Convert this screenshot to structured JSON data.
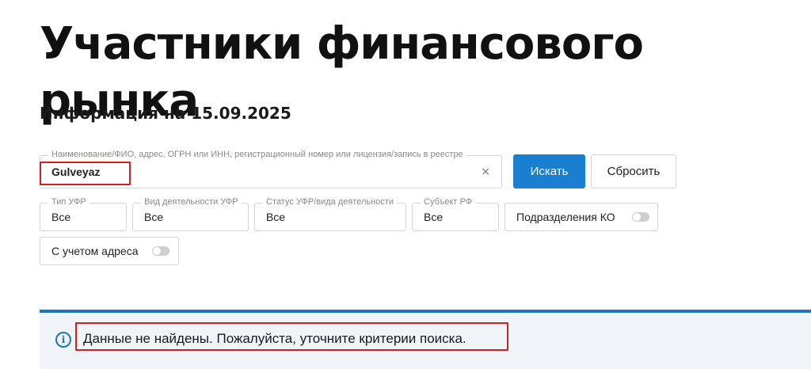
{
  "header": {
    "title": "Участники финансового рынка",
    "info_date": "Информация на 15.09.2025"
  },
  "search": {
    "legend": "Наименование/ФИО, адрес, ОГРН или ИНН, регистрационный номер или лицензия/запись в реестре",
    "value": "Gulveyaz",
    "clear_icon": "×",
    "search_button": "Искать",
    "reset_button": "Сбросить"
  },
  "filters": {
    "type": {
      "legend": "Тип УФР",
      "value": "Все"
    },
    "activity": {
      "legend": "Вид деятельности УФР",
      "value": "Все"
    },
    "status": {
      "legend": "Статус УФР/вида деятельности",
      "value": "Все"
    },
    "subject": {
      "legend": "Субъект РФ",
      "value": "Все"
    },
    "ko_toggle": {
      "label": "Подразделения КО",
      "on": false
    },
    "address_toggle": {
      "label": "С учетом адреса",
      "on": false
    }
  },
  "notice": {
    "icon": "i",
    "text": "Данные не найдены. Пожалуйста, уточните критерии поиска."
  },
  "colors": {
    "accent": "#1a7fd0",
    "highlight": "#d21f1f",
    "notice_bg": "#f0f4f8"
  }
}
